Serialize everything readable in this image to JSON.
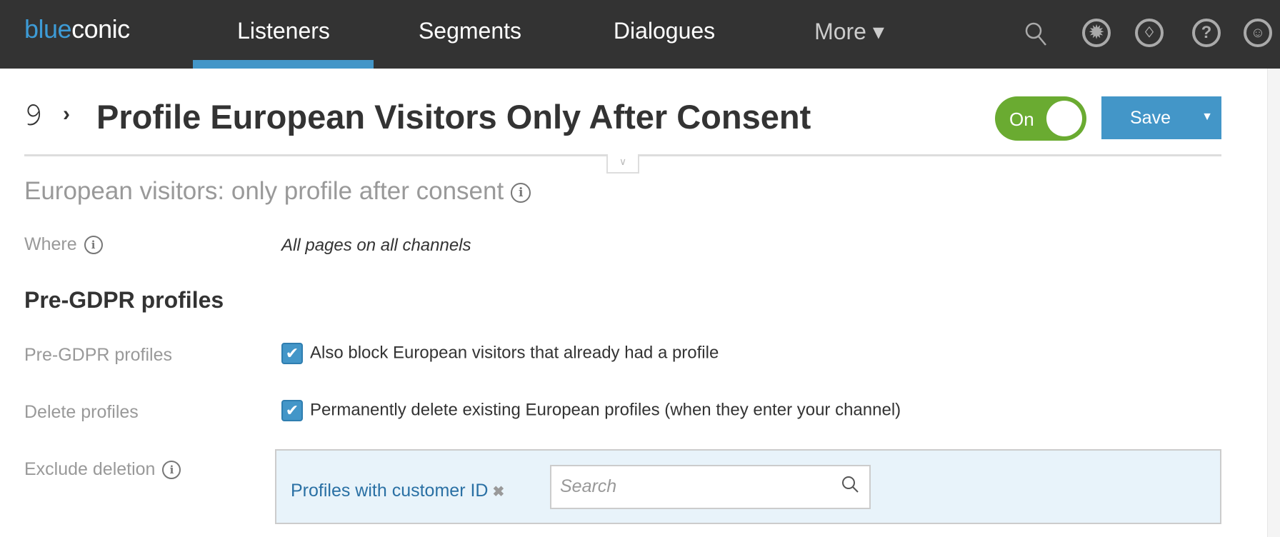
{
  "nav": {
    "logo_blue": "blue",
    "logo_white": "conic",
    "tabs": [
      {
        "label": "Listeners",
        "active": true
      },
      {
        "label": "Segments"
      },
      {
        "label": "Dialogues"
      },
      {
        "label": "More ▾"
      }
    ],
    "icons": [
      "search-icon",
      "gear-icon",
      "bell-icon",
      "help-icon",
      "user-icon"
    ]
  },
  "header": {
    "title": "Profile European Visitors Only After Consent",
    "toggle_label": "On",
    "toggle_on": true,
    "save_label": "Save"
  },
  "subtitle": "European visitors: only profile after consent",
  "where": {
    "label": "Where",
    "value": "All pages on all channels"
  },
  "section_title": "Pre-GDPR profiles",
  "rows": [
    {
      "label": "Pre-GDPR profiles",
      "checkbox_label": "Also block European visitors that already had a profile",
      "checked": true
    },
    {
      "label": "Delete profiles",
      "checkbox_label": "Permanently delete existing European profiles (when they enter your channel)",
      "checked": true
    }
  ],
  "exclude": {
    "label": "Exclude deletion",
    "tag": "Profiles with customer ID",
    "search_placeholder": "Search",
    "search_value": ""
  },
  "colors": {
    "nav_bg": "#333333",
    "accent": "#4396c8",
    "toggle_on": "#6aab31",
    "box_bg": "#e8f3fa"
  }
}
